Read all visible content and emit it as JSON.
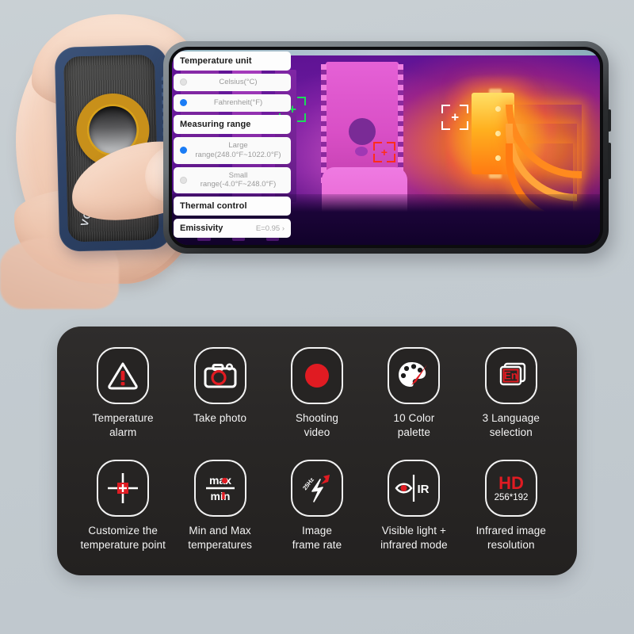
{
  "scene": {
    "description": "Hand holding a thermal imaging camera module attached to a smartphone displaying a thermal image, above a black feature panel",
    "background_color": "#c3cbd0"
  },
  "device": {
    "name": "thermal-camera-module",
    "body_color": "#2f4468",
    "face_color": "#434343",
    "lens_ring_color": "#d9a21b",
    "brand_text": "VO"
  },
  "phone": {
    "frame_color": "#17181a",
    "screen": {
      "thermal_image": {
        "palette": "iron-violet",
        "hot_color": "#ffb01f",
        "cold_color": "#14032e"
      },
      "markers": [
        {
          "name": "spot-green",
          "color": "#1ddc5a",
          "glyph": "+"
        },
        {
          "name": "spot-white",
          "color": "#ffffff",
          "glyph": "+"
        },
        {
          "name": "spot-red",
          "color": "#ff2d1a",
          "glyph": "+"
        }
      ]
    }
  },
  "settings": {
    "sections": [
      {
        "type": "header",
        "label": "Temperature unit"
      },
      {
        "type": "option",
        "label": "Celsius(°C)",
        "selected": false
      },
      {
        "type": "option",
        "label": "Fahrenheit(°F)",
        "selected": true
      },
      {
        "type": "header",
        "label": "Measuring range"
      },
      {
        "type": "option",
        "label": "Large range(248.0°F~1022.0°F)",
        "selected": true
      },
      {
        "type": "option",
        "label": "Small range(-4.0°F~248.0°F)",
        "selected": false
      },
      {
        "type": "header",
        "label": "Thermal control"
      },
      {
        "type": "row",
        "label": "Emissivity",
        "value": "E=0.95 ›"
      }
    ],
    "accent_color": "#1a7cf5"
  },
  "features": {
    "panel_color": "#282625",
    "accent_color": "#e01b22",
    "items": [
      {
        "icon": "warning-triangle-icon",
        "label": "Temperature\nalarm"
      },
      {
        "icon": "camera-icon",
        "label": "Take photo"
      },
      {
        "icon": "record-dot-icon",
        "label": "Shooting\nvideo"
      },
      {
        "icon": "palette-icon",
        "label": "10 Color\npalette"
      },
      {
        "icon": "language-en-icon",
        "label": "3 Language\nselection",
        "badge_text": "En"
      },
      {
        "icon": "crosshair-icon",
        "label": "Customize the\ntemperature point"
      },
      {
        "icon": "max-min-icon",
        "label": "Min and Max\ntemperatures",
        "top_text": "max",
        "bottom_text": "min"
      },
      {
        "icon": "lightning-frame-rate-icon",
        "label": "Image\nframe rate",
        "badge_text": "25Hz"
      },
      {
        "icon": "eye-ir-icon",
        "label": "Visible light +\ninfrared mode",
        "badge_text": "IR"
      },
      {
        "icon": "hd-resolution-icon",
        "label": "Infrared image\nresolution",
        "top_text": "HD",
        "bottom_text": "256*192"
      }
    ]
  }
}
